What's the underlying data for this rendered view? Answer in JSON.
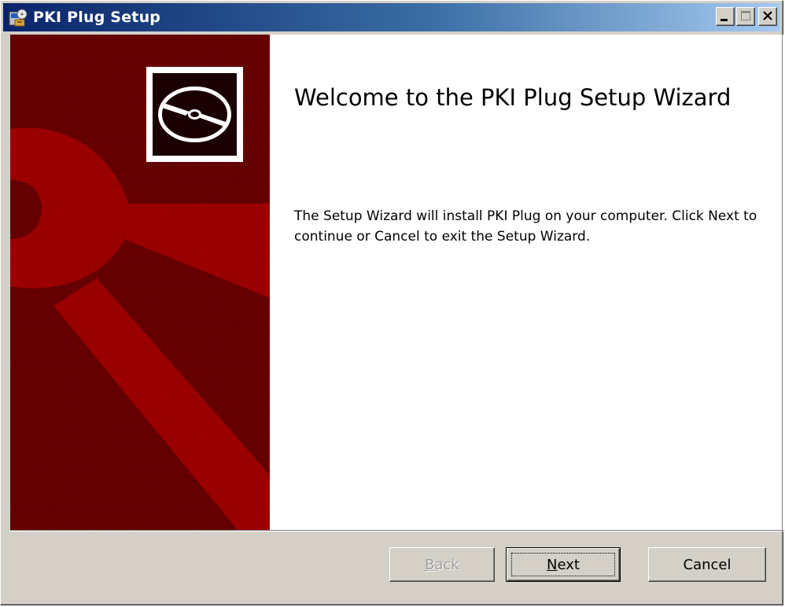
{
  "window": {
    "title": "PKI Plug Setup",
    "icons": {
      "app": "setup-package-icon",
      "minimize": "minimize-icon",
      "maximize": "maximize-icon",
      "close": "close-icon"
    }
  },
  "banner": {
    "icon": "install-disc-icon",
    "colors": {
      "background": "#6a0000",
      "accent": "#9b0000"
    }
  },
  "main": {
    "heading": "Welcome to the PKI Plug Setup Wizard",
    "description": "The Setup Wizard will install PKI Plug on your computer. Click Next to continue or Cancel to exit the Setup Wizard."
  },
  "buttons": {
    "back": "Back",
    "next": "Next",
    "cancel": "Cancel"
  },
  "colors": {
    "titlebar_start": "#0a246a",
    "titlebar_end": "#a6caf0",
    "dialog_face": "#d4d0c8"
  }
}
